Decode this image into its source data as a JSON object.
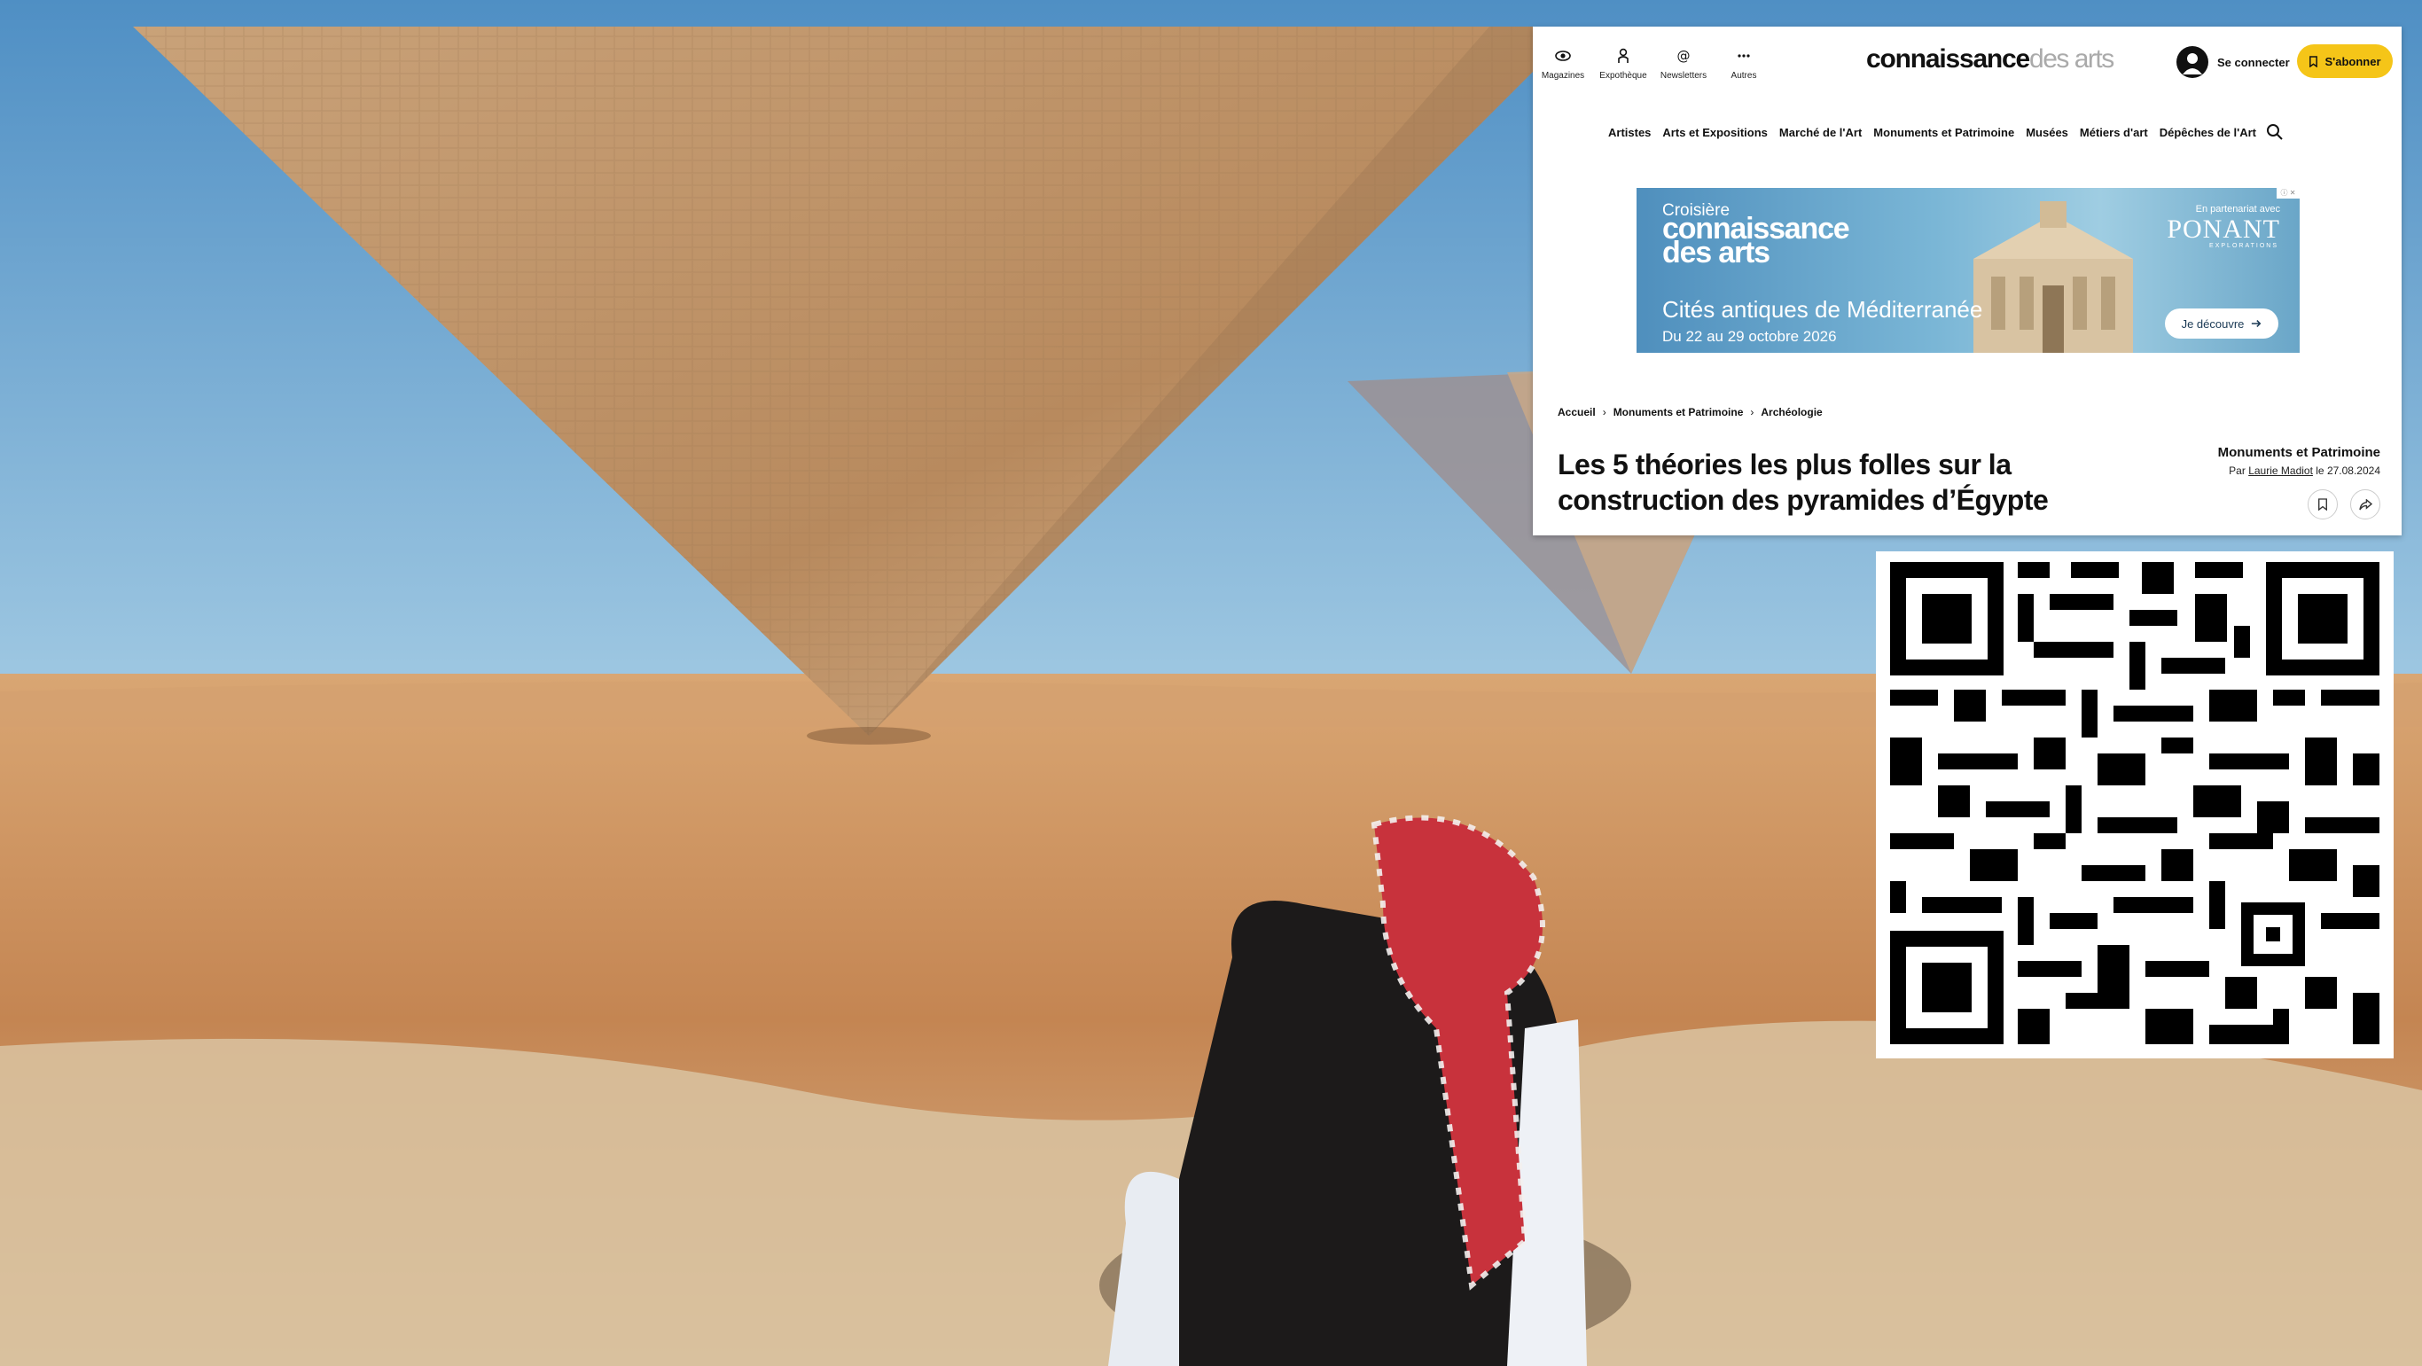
{
  "topbar": {
    "quick_links": [
      {
        "label": "Magazines",
        "icon": "eye-icon"
      },
      {
        "label": "Expothèque",
        "icon": "person-icon"
      },
      {
        "label": "Newsletters",
        "icon": "at-icon"
      },
      {
        "label": "Autres",
        "icon": "more-icon"
      }
    ],
    "logo_main": "connaissance",
    "logo_thin": "des arts",
    "login_label": "Se connecter",
    "subscribe_label": "S'abonner"
  },
  "nav": {
    "items": [
      "Artistes",
      "Arts et Expositions",
      "Marché de l'Art",
      "Monuments et Patrimoine",
      "Musées",
      "Métiers d'art",
      "Dépêches de l'Art"
    ]
  },
  "ad": {
    "tag": "ⓘ ✕",
    "line1": "Croisière",
    "brand_line1": "connaissance",
    "brand_line2": "des arts",
    "title": "Cités antiques de Méditerranée",
    "dates": "Du 22 au 29 octobre 2026",
    "partner": "En partenariat avec",
    "partner_brand": "PONANT",
    "partner_sub": "EXPLORATIONS",
    "cta": "Je découvre"
  },
  "breadcrumb": [
    "Accueil",
    "Monuments et Patrimoine",
    "Archéologie"
  ],
  "article": {
    "headline": "Les 5 théories les plus folles sur la construction des pyramides d’Égypte",
    "category": "Monuments et Patrimoine",
    "by_prefix": "Par",
    "author": "Laurie Madiot",
    "date_text": "le 27.08.2024"
  },
  "colors": {
    "subscribe": "#f5c518",
    "sky": "#6ea9d6",
    "sand": "#c98f5a"
  }
}
